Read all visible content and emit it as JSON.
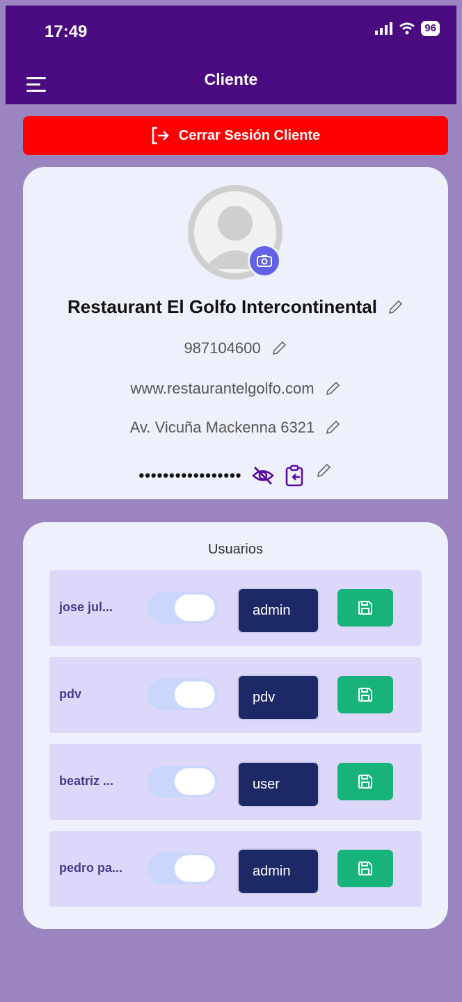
{
  "status": {
    "time": "17:49",
    "battery": "96"
  },
  "header": {
    "title": "Cliente"
  },
  "logout": {
    "label": "Cerrar Sesión Cliente"
  },
  "profile": {
    "name": "Restaurant El Golfo Intercontinental",
    "phone": "987104600",
    "website": "www.restaurantelgolfo.com",
    "address": "Av. Vicuña Mackenna 6321",
    "password_masked": "•••••••••••••••••"
  },
  "users": {
    "title": "Usuarios",
    "rows": [
      {
        "name": "jose jul...",
        "role": "admin",
        "enabled": true
      },
      {
        "name": "pdv",
        "role": "pdv",
        "enabled": true
      },
      {
        "name": "beatriz ...",
        "role": "user",
        "enabled": true
      },
      {
        "name": "pedro pa...",
        "role": "admin",
        "enabled": true
      }
    ]
  },
  "colors": {
    "header": "#4a0a80",
    "logout": "#ff0000",
    "save": "#17b37b",
    "role": "#1d2966",
    "accent": "#6262e6"
  }
}
